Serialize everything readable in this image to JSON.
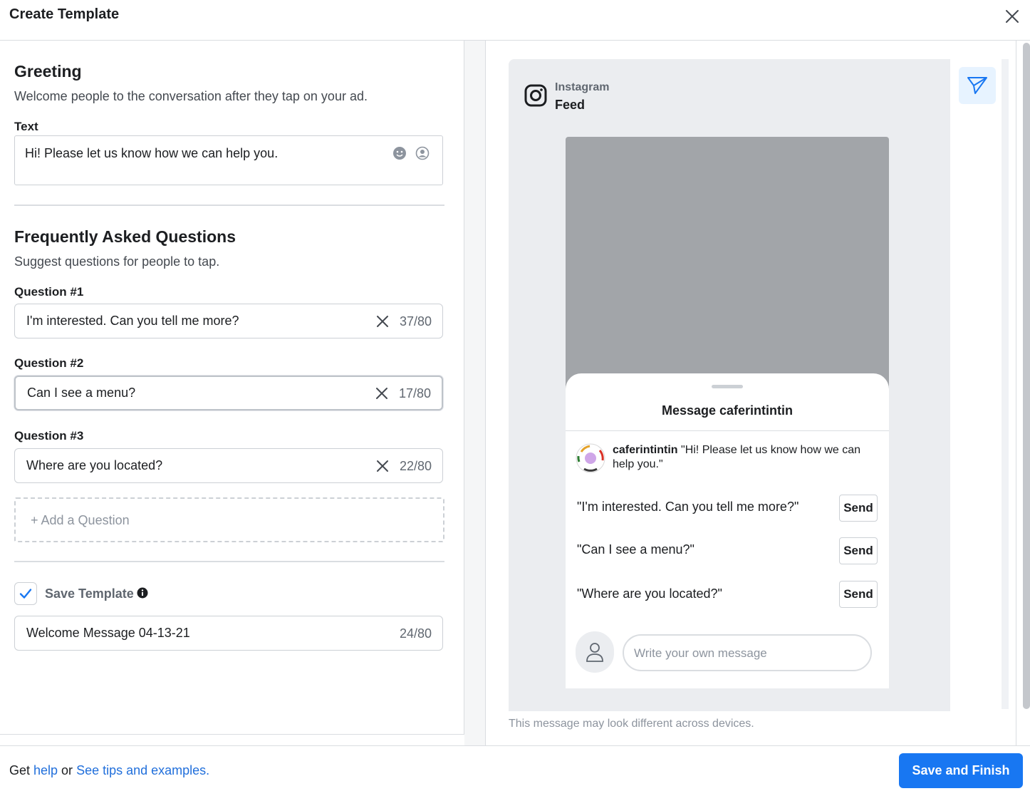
{
  "header": {
    "title": "Create Template",
    "close_icon": "close-icon"
  },
  "greeting": {
    "title": "Greeting",
    "description": "Welcome people to the conversation after they tap on your ad.",
    "text_label": "Text",
    "text_value": "Hi! Please let us know how we can help you.",
    "icons": [
      "emoji-icon",
      "personalize-icon"
    ]
  },
  "faq": {
    "title": "Frequently Asked Questions",
    "description": "Suggest questions for people to tap.",
    "questions": [
      {
        "label": "Question #1",
        "value": "I'm interested. Can you tell me more?",
        "count": "37/80"
      },
      {
        "label": "Question #2",
        "value": "Can I see a menu?",
        "count": "17/80"
      },
      {
        "label": "Question #3",
        "value": "Where are you located?",
        "count": "22/80"
      }
    ],
    "add_label": "+ Add a Question"
  },
  "save_template": {
    "checked": true,
    "label": "Save Template",
    "name_value": "Welcome Message 04-13-21",
    "count": "24/80"
  },
  "preview": {
    "platform": "Instagram",
    "placement": "Feed",
    "sheet_title": "Message caferintintin",
    "account_name": "caferintintin",
    "greeting_quote": "\"Hi! Please let us know how we can help you.\"",
    "questions": [
      {
        "text": "\"I'm interested. Can you tell me more?\"",
        "send": "Send"
      },
      {
        "text": "\"Can I see a menu?\"",
        "send": "Send"
      },
      {
        "text": "\"Where are you located?\"",
        "send": "Send"
      }
    ],
    "message_placeholder": "Write your own message",
    "disclaimer": "This message may look different across devices."
  },
  "footer": {
    "get": "Get ",
    "help": "help",
    "or": " or ",
    "tips": "See tips and examples.",
    "primary": "Save and Finish"
  },
  "colors": {
    "accent": "#1877f2",
    "link": "#216fdb",
    "preview_bg": "#ebedf0",
    "image_placeholder": "#a2a5a9"
  }
}
